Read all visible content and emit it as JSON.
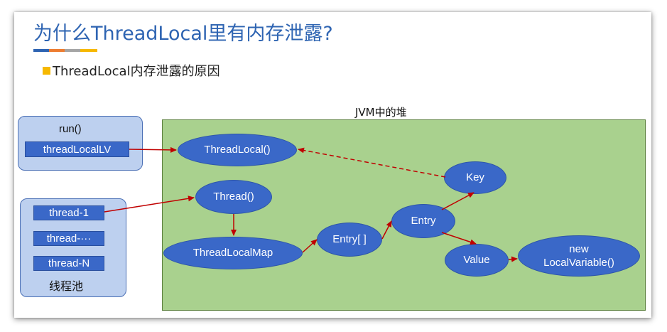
{
  "title": "为什么ThreadLocal里有内存泄露?",
  "title_bar_colors": [
    "#2e64b2",
    "#ed7d31",
    "#a5a5a5",
    "#f6b800"
  ],
  "bullet": "ThreadLocal内存泄露的原因",
  "heap_label": "JVM中的堆",
  "stack": {
    "method": "run()",
    "local_var": "threadLocalLV"
  },
  "thread_pool": {
    "threads": [
      "thread-1",
      "thread-···",
      "thread-N"
    ],
    "label": "线程池"
  },
  "heap_nodes": {
    "threadlocal": "ThreadLocal()",
    "thread": "Thread()",
    "threadlocalmap": "ThreadLocalMap",
    "entry_array": "Entry[ ]",
    "entry": "Entry",
    "key": "Key",
    "value": "Value",
    "new_local_variable": "new LocalVariable()"
  },
  "colors": {
    "node_fill": "#3a68c8",
    "heap_fill": "#a9d18e",
    "arrow": "#c00000",
    "stack_fill": "#bdd0ef"
  }
}
